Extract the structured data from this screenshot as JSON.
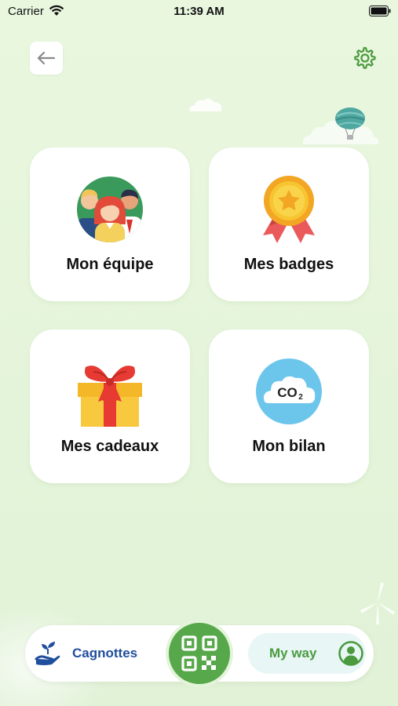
{
  "status_bar": {
    "carrier": "Carrier",
    "time": "11:39 AM",
    "icons": [
      "wifi-icon",
      "battery-icon"
    ]
  },
  "header": {
    "back_icon": "arrow-left-icon",
    "settings_icon": "gear-icon"
  },
  "cards": [
    {
      "label": "Mon équipe",
      "icon": "team-illustration"
    },
    {
      "label": "Mes badges",
      "icon": "medal-illustration"
    },
    {
      "label": "Mes cadeaux",
      "icon": "gift-illustration"
    },
    {
      "label": "Mon bilan",
      "icon": "co2-cloud-illustration"
    }
  ],
  "co2_text": "CO",
  "co2_sub": "2",
  "bottom_nav": {
    "left_label": "Cagnottes",
    "left_icon": "hand-plant-icon",
    "center_icon": "qr-code-icon",
    "right_label": "My way",
    "right_icon": "user-circle-icon"
  },
  "colors": {
    "background": "#e6f5dc",
    "accent_green": "#57a84a",
    "nav_blue": "#1f4e9c",
    "card": "#ffffff"
  }
}
